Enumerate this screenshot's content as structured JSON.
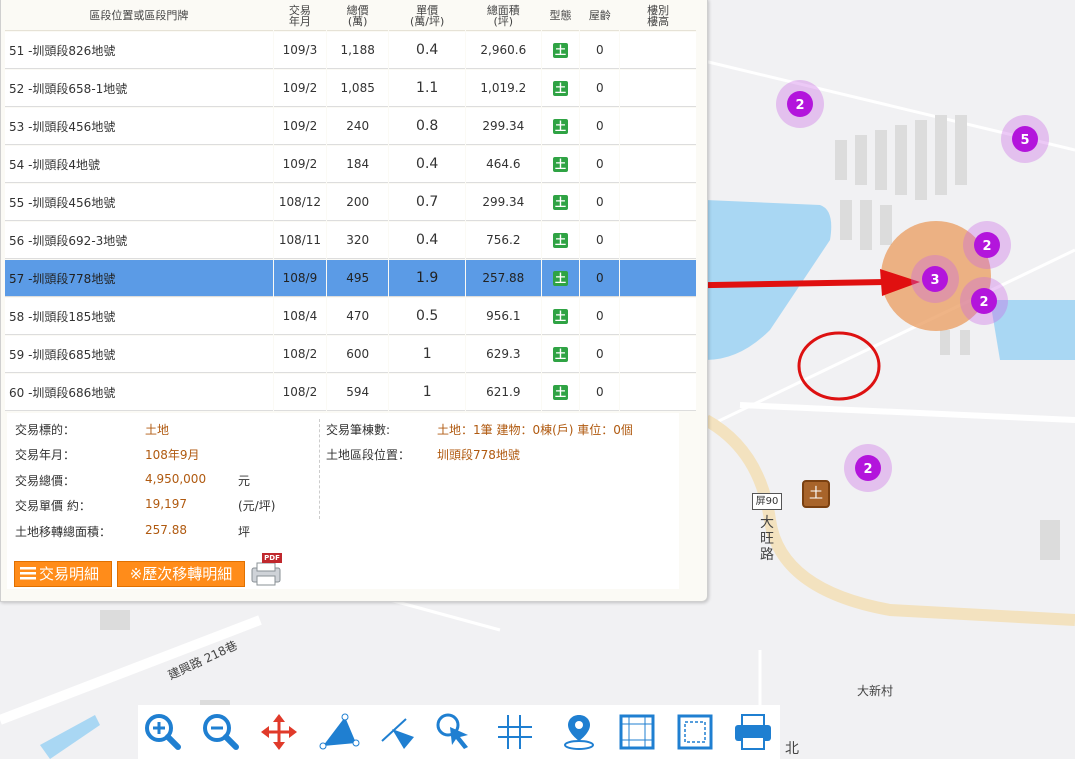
{
  "table": {
    "headers": {
      "addr": "區段位置或區段門牌",
      "date": "交易\n年月",
      "total": "總價\n(萬)",
      "unit": "單價\n(萬/坪)",
      "area": "總面積\n(坪)",
      "type": "型態",
      "age": "屋齡",
      "floor": "樓別\n樓高"
    },
    "rows": [
      {
        "addr": "51 -圳頭段826地號",
        "date": "109/3",
        "total": "1,188",
        "unit": "0.4",
        "area": "2,960.6",
        "type": "土",
        "age": "0",
        "floor": ""
      },
      {
        "addr": "52 -圳頭段658-1地號",
        "date": "109/2",
        "total": "1,085",
        "unit": "1.1",
        "area": "1,019.2",
        "type": "土",
        "age": "0",
        "floor": ""
      },
      {
        "addr": "53 -圳頭段456地號",
        "date": "109/2",
        "total": "240",
        "unit": "0.8",
        "area": "299.34",
        "type": "土",
        "age": "0",
        "floor": ""
      },
      {
        "addr": "54 -圳頭段4地號",
        "date": "109/2",
        "total": "184",
        "unit": "0.4",
        "area": "464.6",
        "type": "土",
        "age": "0",
        "floor": ""
      },
      {
        "addr": "55 -圳頭段456地號",
        "date": "108/12",
        "total": "200",
        "unit": "0.7",
        "area": "299.34",
        "type": "土",
        "age": "0",
        "floor": ""
      },
      {
        "addr": "56 -圳頭段692-3地號",
        "date": "108/11",
        "total": "320",
        "unit": "0.4",
        "area": "756.2",
        "type": "土",
        "age": "0",
        "floor": ""
      },
      {
        "addr": "57 -圳頭段778地號",
        "date": "108/9",
        "total": "495",
        "unit": "1.9",
        "area": "257.88",
        "type": "土",
        "age": "0",
        "floor": "",
        "selected": true
      },
      {
        "addr": "58 -圳頭段185地號",
        "date": "108/4",
        "total": "470",
        "unit": "0.5",
        "area": "956.1",
        "type": "土",
        "age": "0",
        "floor": ""
      },
      {
        "addr": "59 -圳頭段685地號",
        "date": "108/2",
        "total": "600",
        "unit": "1",
        "area": "629.3",
        "type": "土",
        "age": "0",
        "floor": ""
      },
      {
        "addr": "60 -圳頭段686地號",
        "date": "108/2",
        "total": "594",
        "unit": "1",
        "area": "621.9",
        "type": "土",
        "age": "0",
        "floor": ""
      }
    ]
  },
  "details": {
    "target_label": "交易標的：",
    "target_value": "土地",
    "ym_label": "交易年月：",
    "ym_value": "108年9月",
    "total_label": "交易總價：",
    "total_value": "4,950,000",
    "total_unit": "元",
    "unit_label": "交易單價 約：",
    "unit_value": "19,197",
    "unit_unit": "(元/坪)",
    "area_label": "土地移轉總面積：",
    "area_value": "257.88",
    "area_unit": "坪",
    "count_label": "交易筆棟數:",
    "count_value": "土地：1筆 建物：0棟(戶) 車位：0個",
    "location_label": "土地區段位置：",
    "location_value": "圳頭段778地號"
  },
  "buttons": {
    "detail": "交易明細",
    "history": "※歷次移轉明細",
    "pdf_badge": "PDF"
  },
  "map": {
    "clusters": [
      "2",
      "5",
      "2",
      "3",
      "2",
      "2"
    ],
    "road_sign": "屏90",
    "road_name": "大旺路",
    "village": "大新村",
    "street": "建興路 218巷",
    "edge_text": "北",
    "land_marker": "土"
  },
  "toolbar": [
    "zoom-in-icon",
    "zoom-out-icon",
    "pan-icon",
    "measure-area-icon",
    "measure-distance-icon",
    "select-point-icon",
    "grid-icon",
    "locate-icon",
    "frame-icon",
    "frame-dashed-icon",
    "print-icon"
  ]
}
